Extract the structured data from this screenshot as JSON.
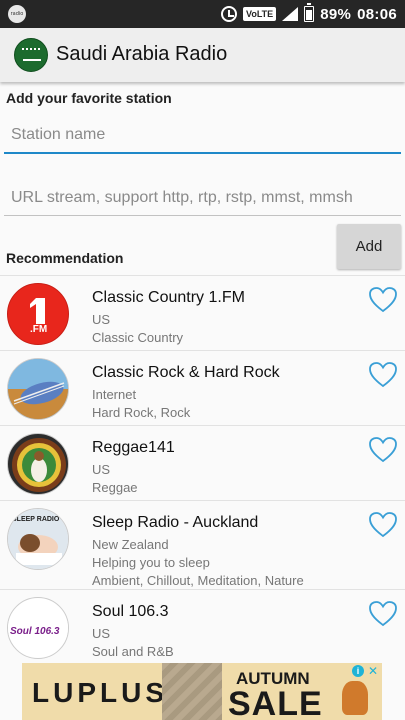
{
  "status_bar": {
    "battery": "89%",
    "time": "08:06",
    "network": "VoLTE",
    "signal": "4G+"
  },
  "app": {
    "title": "Saudi Arabia Radio"
  },
  "form": {
    "heading": "Add your favorite station",
    "station_placeholder": "Station name",
    "url_placeholder": "URL stream, support http, rtp, rstp, mmst, mmsh",
    "add_label": "Add"
  },
  "recommendation_heading": "Recommendation",
  "stations": [
    {
      "name": "Classic Country 1.FM",
      "country": "US",
      "genre": "Classic Country"
    },
    {
      "name": "Classic Rock & Hard Rock",
      "country": "Internet",
      "genre": "Hard Rock, Rock"
    },
    {
      "name": "Reggae141",
      "country": "US",
      "genre": "Reggae"
    },
    {
      "name": "Sleep Radio - Auckland",
      "country": "New Zealand",
      "tagline": "Helping you to sleep",
      "genre": "Ambient, Chillout, Meditation, Nature"
    },
    {
      "name": "Soul 106.3",
      "country": "US",
      "genre": "Soul and R&B"
    }
  ],
  "logos": {
    "onefm": ".FM",
    "sleep": "SLEEP RADIO",
    "soul": "Soul 106.3"
  },
  "ad": {
    "brand": "LUPLUS",
    "line1": "AUTUMN",
    "line2": "SALE"
  },
  "colors": {
    "accent": "#1e88c8",
    "heart": "#3a9fd6",
    "status_bar": "#262626",
    "app_bar": "#eeeeee"
  },
  "icons": [
    "notification-icon",
    "alarm-icon",
    "signal-icon",
    "battery-icon",
    "saudi-flag-icon",
    "heart-icon",
    "ad-info-icon",
    "ad-close-icon"
  ]
}
